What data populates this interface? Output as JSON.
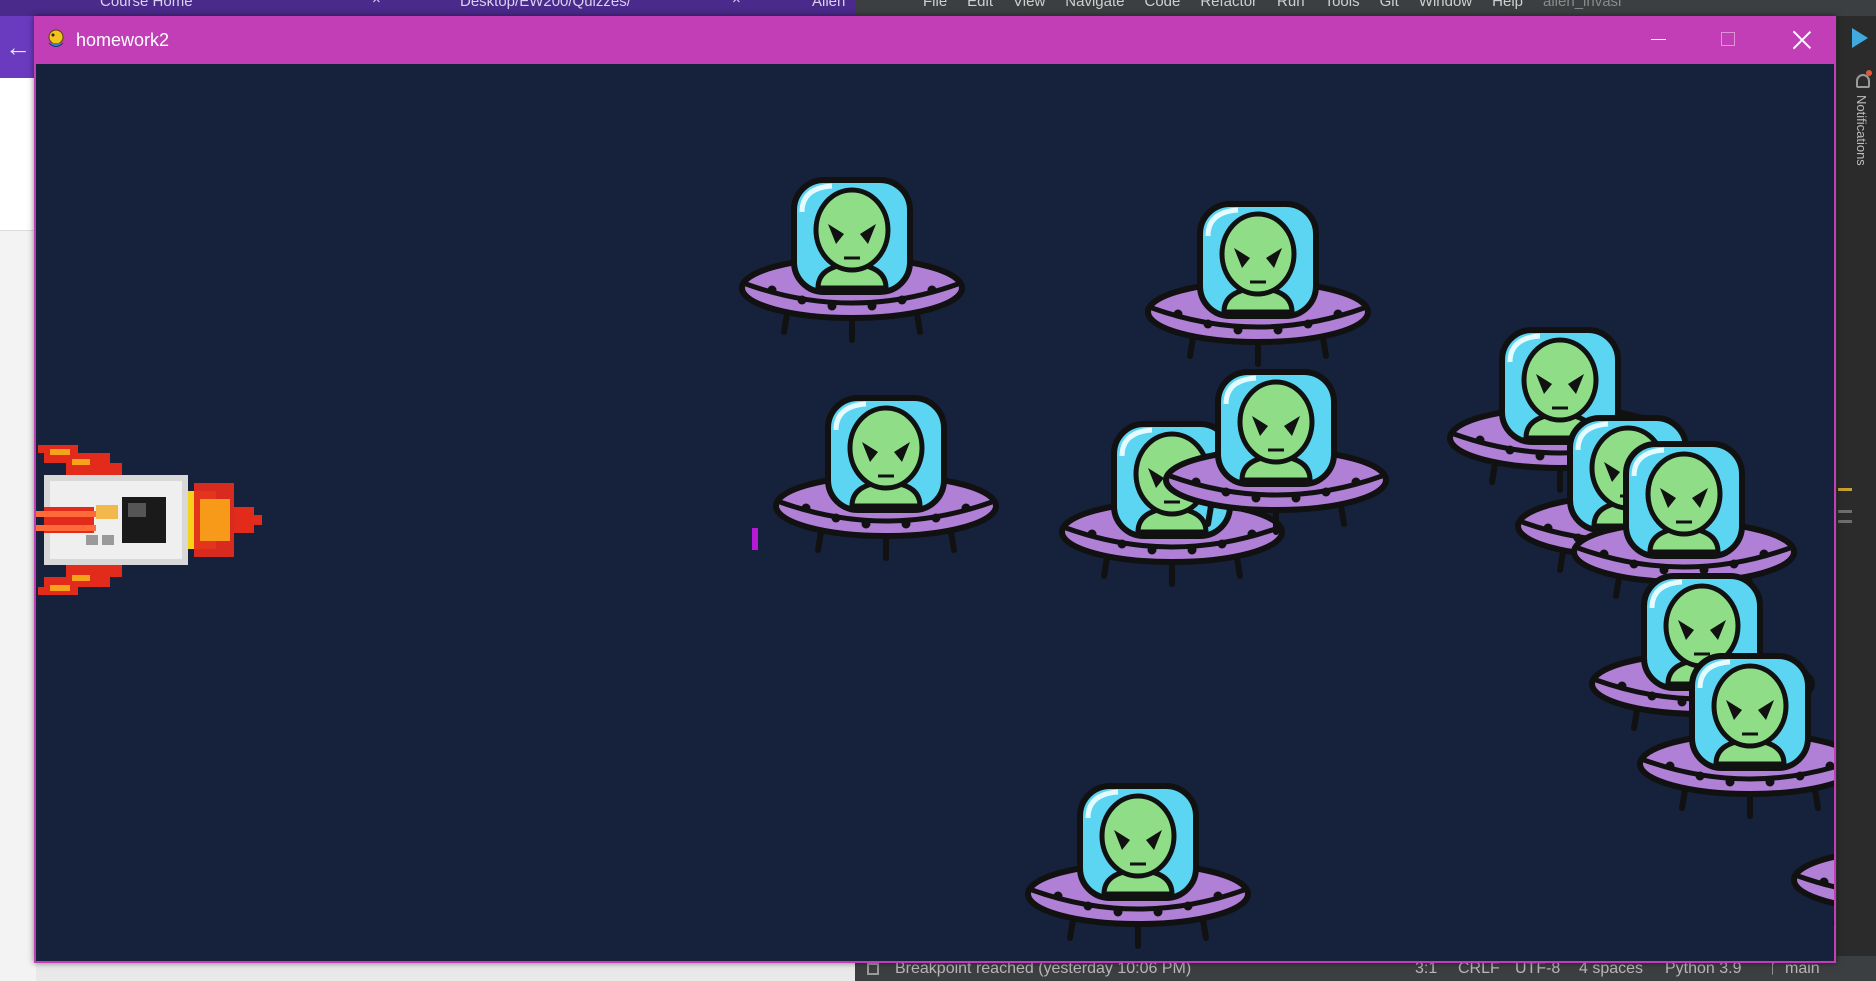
{
  "background": {
    "browser_tabs": [
      {
        "label": "Course Home"
      },
      {
        "label": "Desktop/EW200/Quizzes/"
      },
      {
        "label": "Alien"
      }
    ],
    "ide_menu": [
      "File",
      "Edit",
      "View",
      "Navigate",
      "Code",
      "Refactor",
      "Run",
      "Tools",
      "Git",
      "Window",
      "Help",
      "alien_invasi"
    ],
    "notifications_label": "Notifications",
    "statusbar": {
      "message": "Breakpoint reached (yesterday 10:06 PM)",
      "position": "3:1",
      "line_ending": "CRLF",
      "encoding": "UTF-8",
      "indent": "4 spaces",
      "interpreter": "Python 3.9",
      "branch": "main"
    }
  },
  "window": {
    "title": "homework2",
    "titlebar_color": "#c13eb6",
    "controls": {
      "minimize": "minimize-icon",
      "maximize": "maximize-icon",
      "close": "close-icon"
    }
  },
  "game": {
    "background_color": "#16213b",
    "player": {
      "sprite": "rocket-ship"
    },
    "bullet_color": "#b51ad6",
    "alien_count": 14,
    "alien_sprite": "alien-in-flying-saucer"
  }
}
